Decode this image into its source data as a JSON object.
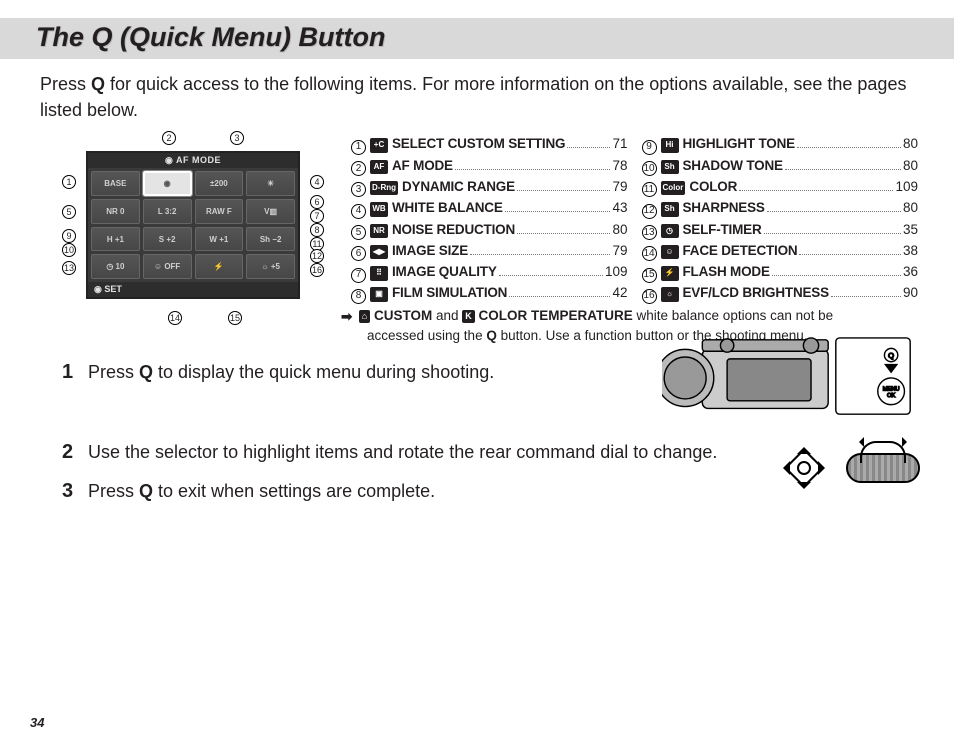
{
  "page_number": "34",
  "title": "The Q (Quick Menu) Button",
  "intro_pre": "Press ",
  "intro_q": "Q",
  "intro_post": " for quick access to the following items.  For more information on the options available, see the pages listed below.",
  "lcd": {
    "top_label": "AF MODE",
    "set_label": "SET",
    "cells": [
      "BASE",
      "◉",
      "±200",
      "☀",
      "NR 0",
      "L 3:2",
      "RAW F",
      "V▥",
      "H +1",
      "S +2",
      "W +1",
      "Sh −2",
      "◷ 10",
      "☺ OFF",
      "⚡",
      "☼ +5"
    ],
    "highlight_index": 1
  },
  "callouts": [
    {
      "n": "1",
      "style": "left:16px;top:44px"
    },
    {
      "n": "2",
      "style": "left:116px;top:0px"
    },
    {
      "n": "3",
      "style": "left:184px;top:0px"
    },
    {
      "n": "4",
      "style": "left:264px;top:44px"
    },
    {
      "n": "5",
      "style": "left:16px;top:74px"
    },
    {
      "n": "6",
      "style": "left:140px;top:74px; display:none"
    },
    {
      "n": "6",
      "style": "left:264px;top:64px"
    },
    {
      "n": "7",
      "style": "left:264px;top:78px"
    },
    {
      "n": "8",
      "style": "left:264px;top:92px"
    },
    {
      "n": "9",
      "style": "left:16px;top:98px"
    },
    {
      "n": "10",
      "style": "left:16px;top:112px"
    },
    {
      "n": "11",
      "style": "left:264px;top:106px"
    },
    {
      "n": "12",
      "style": "left:264px;top:118px"
    },
    {
      "n": "13",
      "style": "left:16px;top:130px"
    },
    {
      "n": "14",
      "style": "left:122px;top:180px"
    },
    {
      "n": "15",
      "style": "left:182px;top:180px"
    },
    {
      "n": "16",
      "style": "left:264px;top:132px"
    }
  ],
  "index_left": [
    {
      "n": "1",
      "icon": "+C",
      "label": "SELECT CUSTOM SETTING",
      "page": "71"
    },
    {
      "n": "2",
      "icon": "AF",
      "label": "AF MODE",
      "page": "78"
    },
    {
      "n": "3",
      "icon": "D-Rng",
      "label": "DYNAMIC RANGE",
      "page": "79"
    },
    {
      "n": "4",
      "icon": "WB",
      "label": "WHITE BALANCE",
      "page": "43"
    },
    {
      "n": "5",
      "icon": "NR",
      "label": "NOISE REDUCTION",
      "page": "80"
    },
    {
      "n": "6",
      "icon": "◀▶",
      "label": "IMAGE SIZE",
      "page": "79"
    },
    {
      "n": "7",
      "icon": "⠿",
      "label": "IMAGE QUALITY",
      "page": "109"
    },
    {
      "n": "8",
      "icon": "▣",
      "label": "FILM SIMULATION",
      "page": "42"
    }
  ],
  "index_right": [
    {
      "n": "9",
      "icon": "Hi",
      "label": "HIGHLIGHT TONE",
      "page": "80"
    },
    {
      "n": "10",
      "icon": "Sh",
      "label": "SHADOW TONE",
      "page": "80"
    },
    {
      "n": "11",
      "icon": "Color",
      "label": "COLOR",
      "page": "109"
    },
    {
      "n": "12",
      "icon": "Sh",
      "label": "SHARPNESS",
      "page": "80"
    },
    {
      "n": "13",
      "icon": "◷",
      "label": "SELF-TIMER",
      "page": "35"
    },
    {
      "n": "14",
      "icon": "☺",
      "label": "FACE DETECTION",
      "page": "38"
    },
    {
      "n": "15",
      "icon": "⚡",
      "label": "FLASH MODE",
      "page": "36"
    },
    {
      "n": "16",
      "icon": "☼",
      "label": "EVF/LCD BRIGHTNESS",
      "page": "90"
    }
  ],
  "note": {
    "part1": " CUSTOM",
    "part2": " and ",
    "part3": " COLOR TEMPERATURE",
    "part4": " white balance options can not be",
    "line2": "accessed using the ",
    "q": "Q",
    "line2b": " button.  Use a function button or the shooting menu."
  },
  "steps": [
    {
      "n": "1",
      "pre": "Press ",
      "q": "Q",
      "post": " to display the quick menu during shooting."
    },
    {
      "n": "2",
      "pre": "Use the selector to highlight items and rotate the rear command dial to change.",
      "q": "",
      "post": ""
    },
    {
      "n": "3",
      "pre": "Press ",
      "q": "Q",
      "post": " to exit when settings are complete."
    }
  ]
}
